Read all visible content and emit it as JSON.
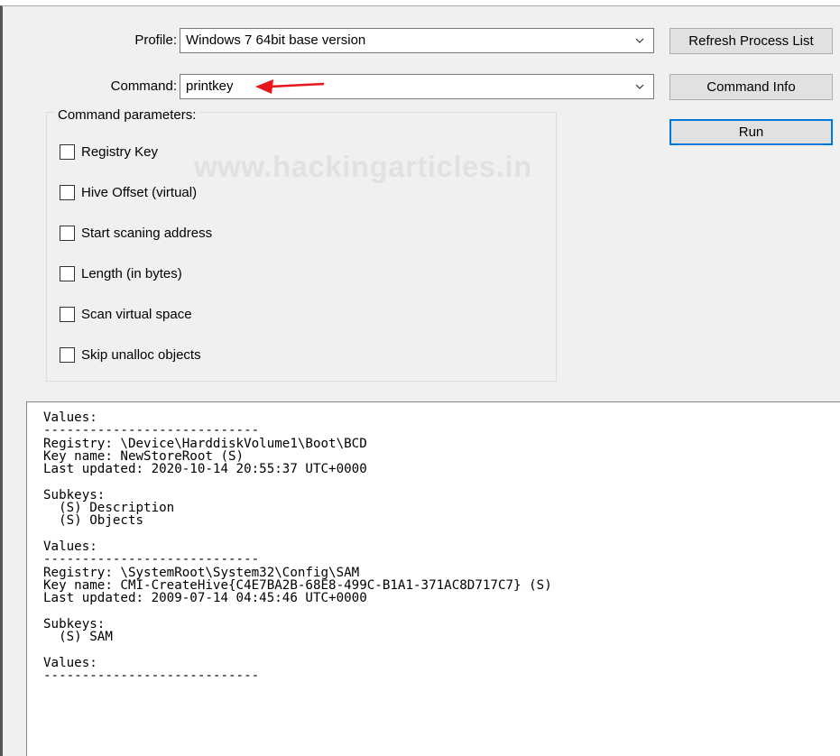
{
  "profile": {
    "label": "Profile:",
    "value": "Windows 7 64bit base version"
  },
  "command": {
    "label": "Command:",
    "value": "printkey"
  },
  "buttons": {
    "refresh": "Refresh Process List",
    "command_info": "Command Info",
    "run": "Run"
  },
  "params": {
    "legend": "Command parameters:",
    "options": [
      {
        "label": "Registry Key",
        "checked": false
      },
      {
        "label": "Hive Offset (virtual)",
        "checked": false
      },
      {
        "label": "Start scaning address",
        "checked": false
      },
      {
        "label": "Length (in bytes)",
        "checked": false
      },
      {
        "label": "Scan virtual space",
        "checked": false
      },
      {
        "label": "Skip unalloc objects",
        "checked": false
      }
    ]
  },
  "watermark": "www.hackingarticles.in",
  "annotation": {
    "arrow_color": "#e8151b"
  },
  "output": {
    "text": "Values:\n----------------------------\nRegistry: \\Device\\HarddiskVolume1\\Boot\\BCD\nKey name: NewStoreRoot (S)\nLast updated: 2020-10-14 20:55:37 UTC+0000\n\nSubkeys:\n  (S) Description\n  (S) Objects\n\nValues:\n----------------------------\nRegistry: \\SystemRoot\\System32\\Config\\SAM\nKey name: CMI-CreateHive{C4E7BA2B-68E8-499C-B1A1-371AC8D717C7} (S)\nLast updated: 2009-07-14 04:45:46 UTC+0000\n\nSubkeys:\n  (S) SAM\n\nValues:\n----------------------------"
  }
}
